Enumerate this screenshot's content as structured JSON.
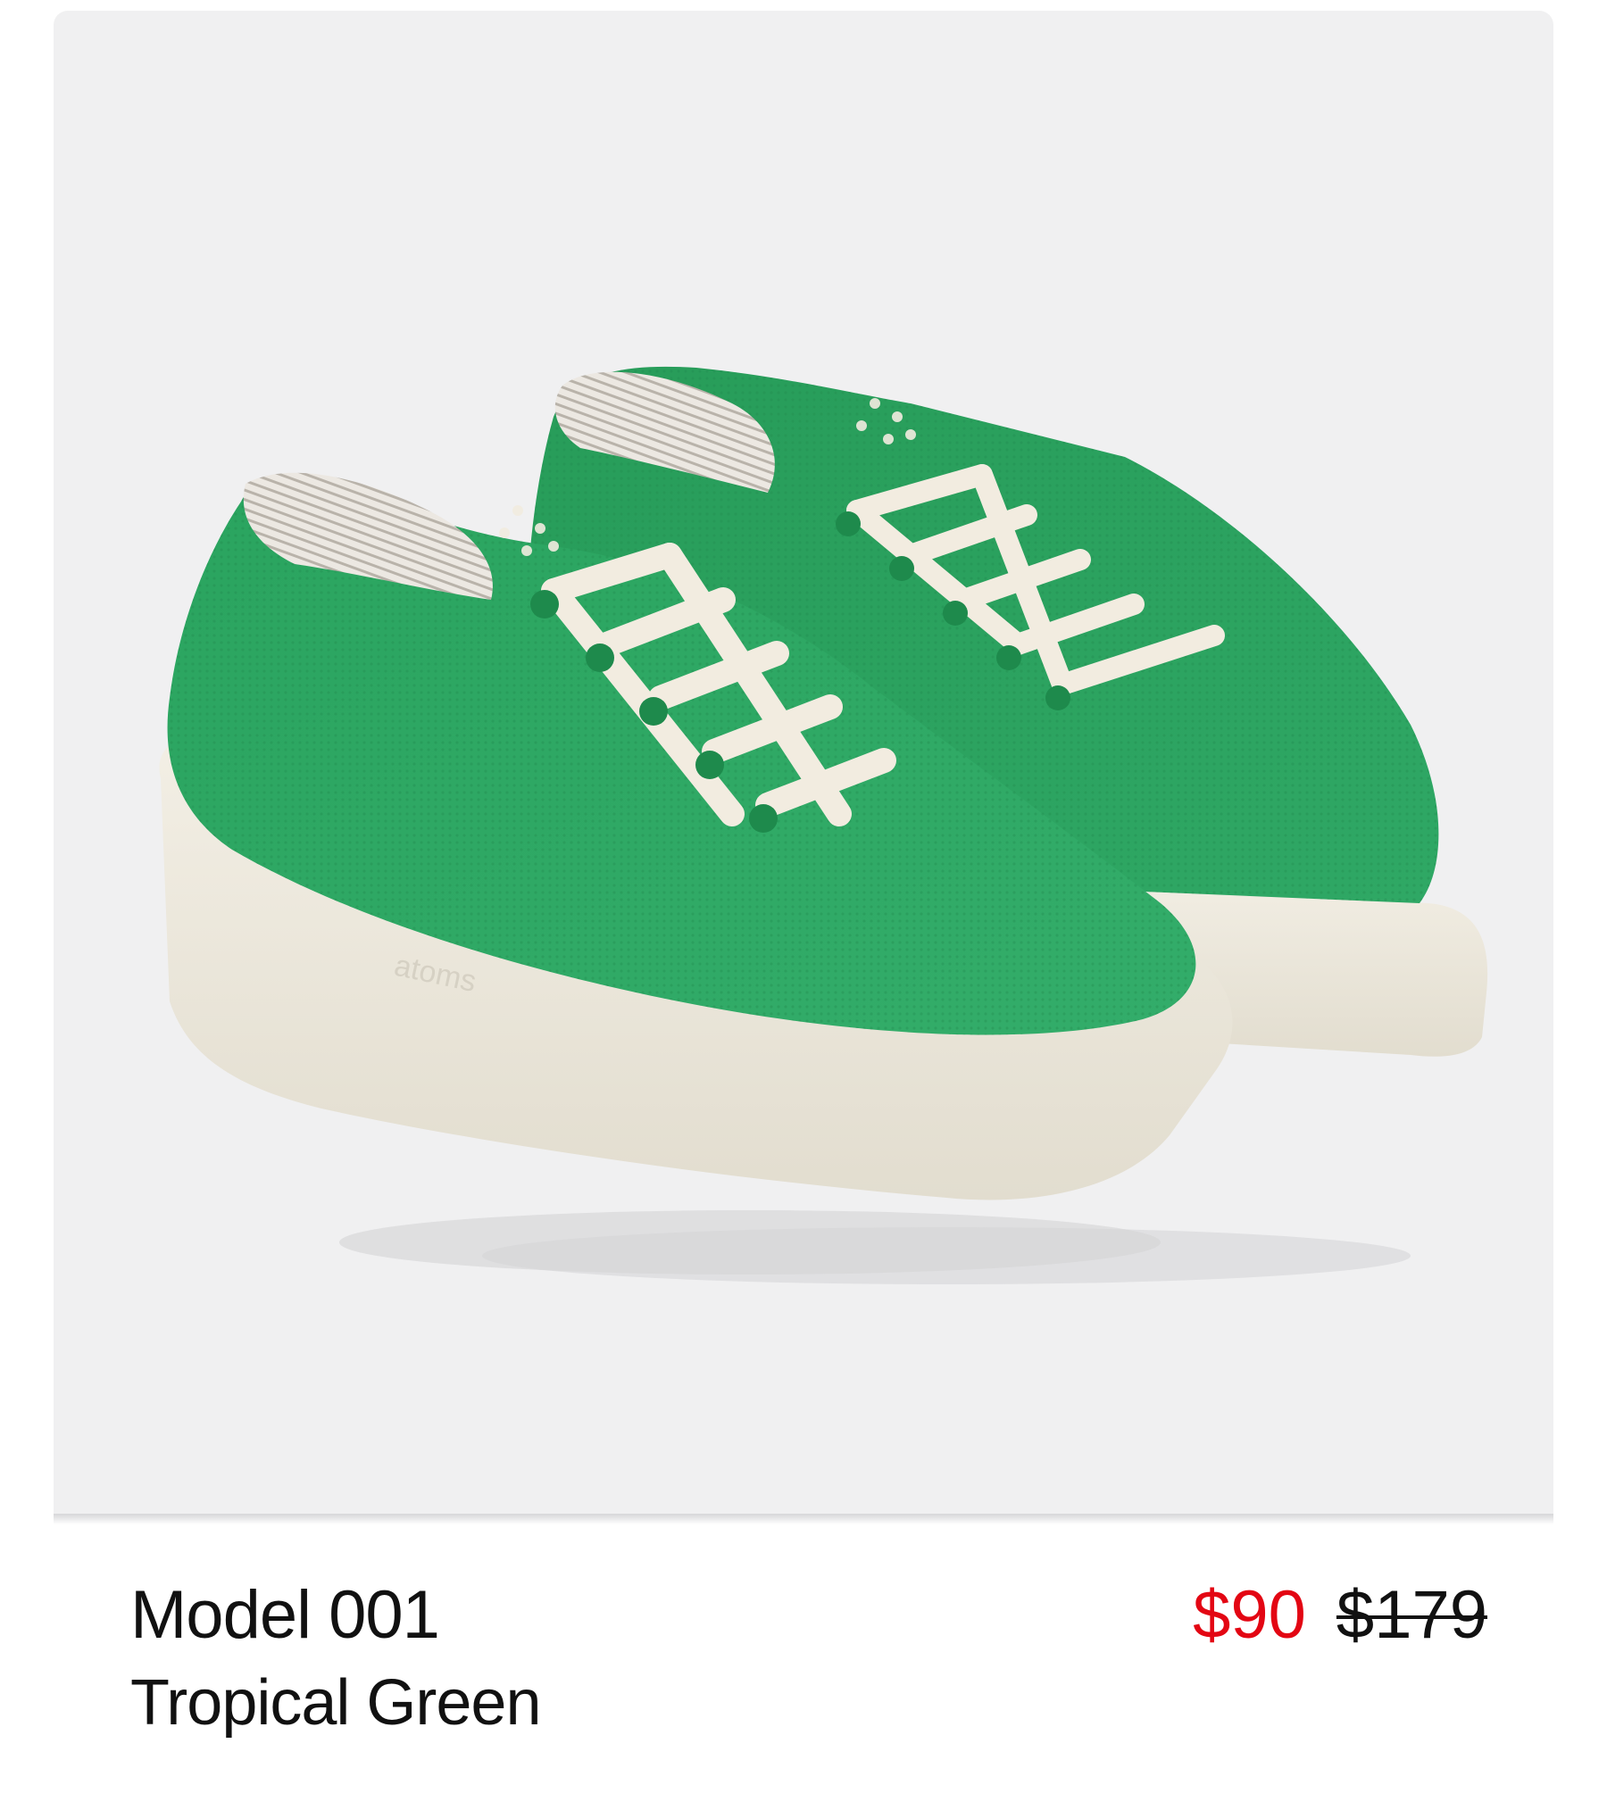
{
  "product": {
    "name": "Model 001",
    "color_name": "Tropical Green",
    "sale_price": "$90",
    "original_price": "$179",
    "image_alt": "green knit sneakers with white laces",
    "sole_brand": "atoms"
  },
  "colors": {
    "sale": "#e30613",
    "upper_green": "#2fa261",
    "sole_cream": "#ece8dc",
    "background": "#f0f0f1"
  }
}
